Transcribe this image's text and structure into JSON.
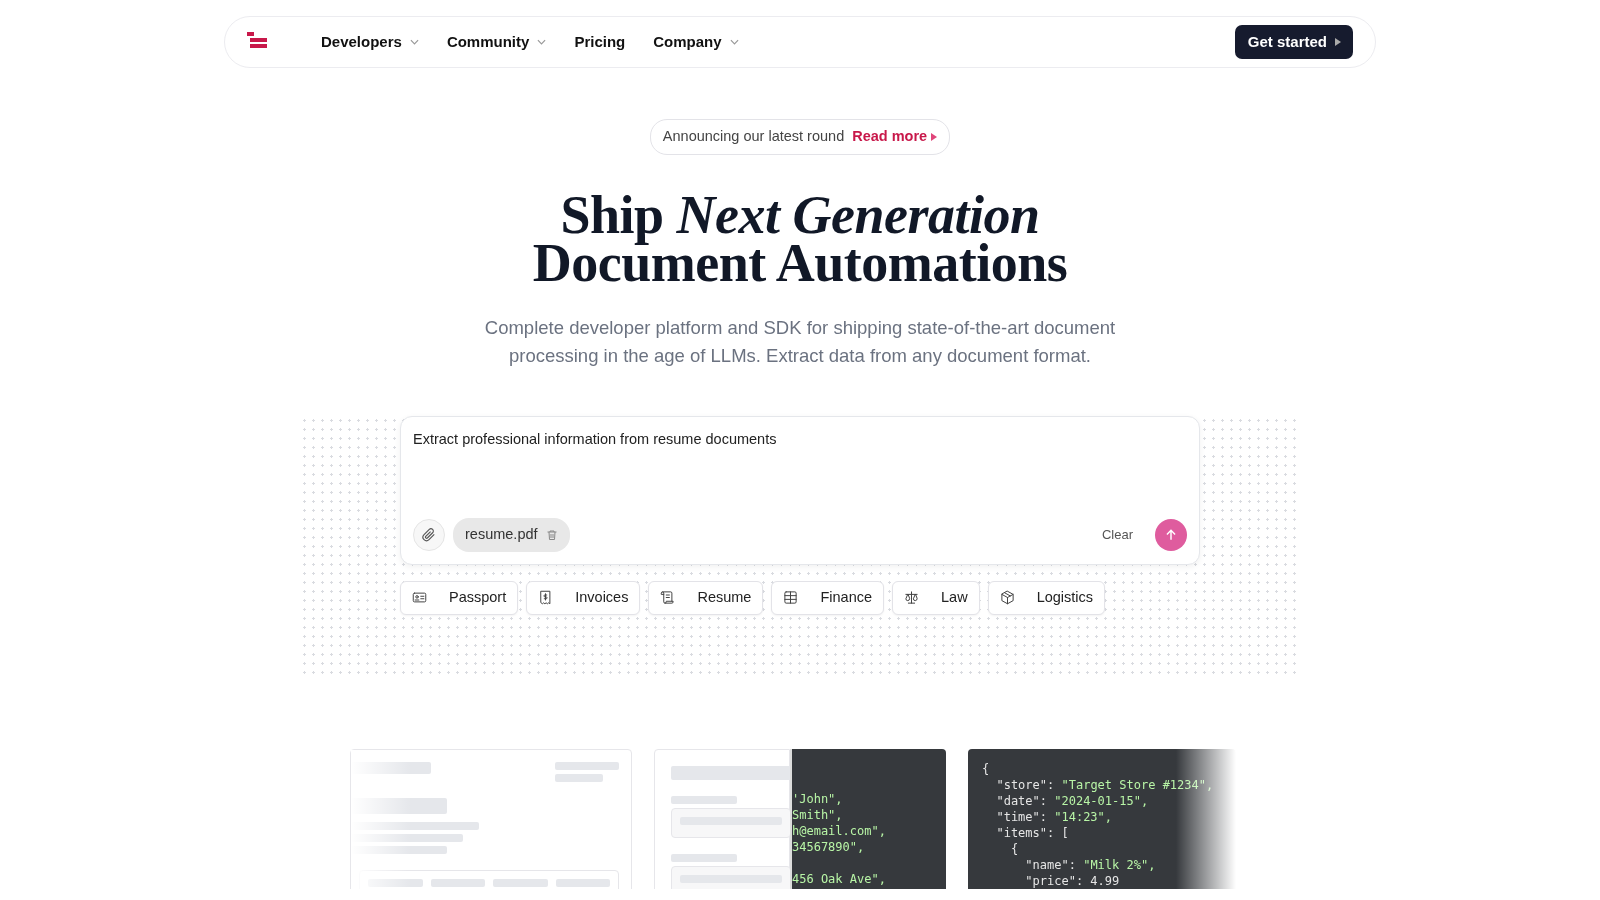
{
  "navbar": {
    "items": [
      {
        "label": "Developers",
        "dropdown": true
      },
      {
        "label": "Community",
        "dropdown": true
      },
      {
        "label": "Pricing",
        "dropdown": false
      },
      {
        "label": "Company",
        "dropdown": true
      }
    ],
    "cta": "Get started"
  },
  "announcement": {
    "text": "Announcing our latest round",
    "link": "Read more"
  },
  "hero": {
    "title_lines": [
      "Ship *Next Generation*",
      "Document Automations"
    ],
    "subtitle": "Complete developer platform and SDK for shipping state-of-the-art document processing in the age of LLMs. Extract data from any document format."
  },
  "prompt": {
    "value": "Extract professional information from resume documents",
    "attachment": "resume.pdf",
    "clear": "Clear"
  },
  "chips": [
    {
      "label": "Passport"
    },
    {
      "label": "Invoices"
    },
    {
      "label": "Resume"
    },
    {
      "label": "Finance"
    },
    {
      "label": "Law"
    },
    {
      "label": "Logistics"
    }
  ],
  "code_panels": [
    {
      "lines": [
        {
          "value": "'John\","
        },
        {
          "value": "Smith\","
        },
        {
          "value": "h@email.com\","
        },
        {
          "value": "34567890\","
        },
        {
          "value": "456 Oak Ave\",",
          "gap_before": true
        }
      ]
    },
    {
      "lines": [
        {
          "key": "{"
        },
        {
          "key": "  \"store\": ",
          "value": "\"Target Store #1234\","
        },
        {
          "key": "  \"date\": ",
          "value": "\"2024-01-15\","
        },
        {
          "key": "  \"time\": ",
          "value": "\"14:23\","
        },
        {
          "key": "  \"items\": ["
        },
        {
          "key": "    {"
        },
        {
          "key": "      \"name\": ",
          "value": "\"Milk 2%\","
        },
        {
          "key": "      \"price\": 4.99"
        }
      ]
    }
  ]
}
